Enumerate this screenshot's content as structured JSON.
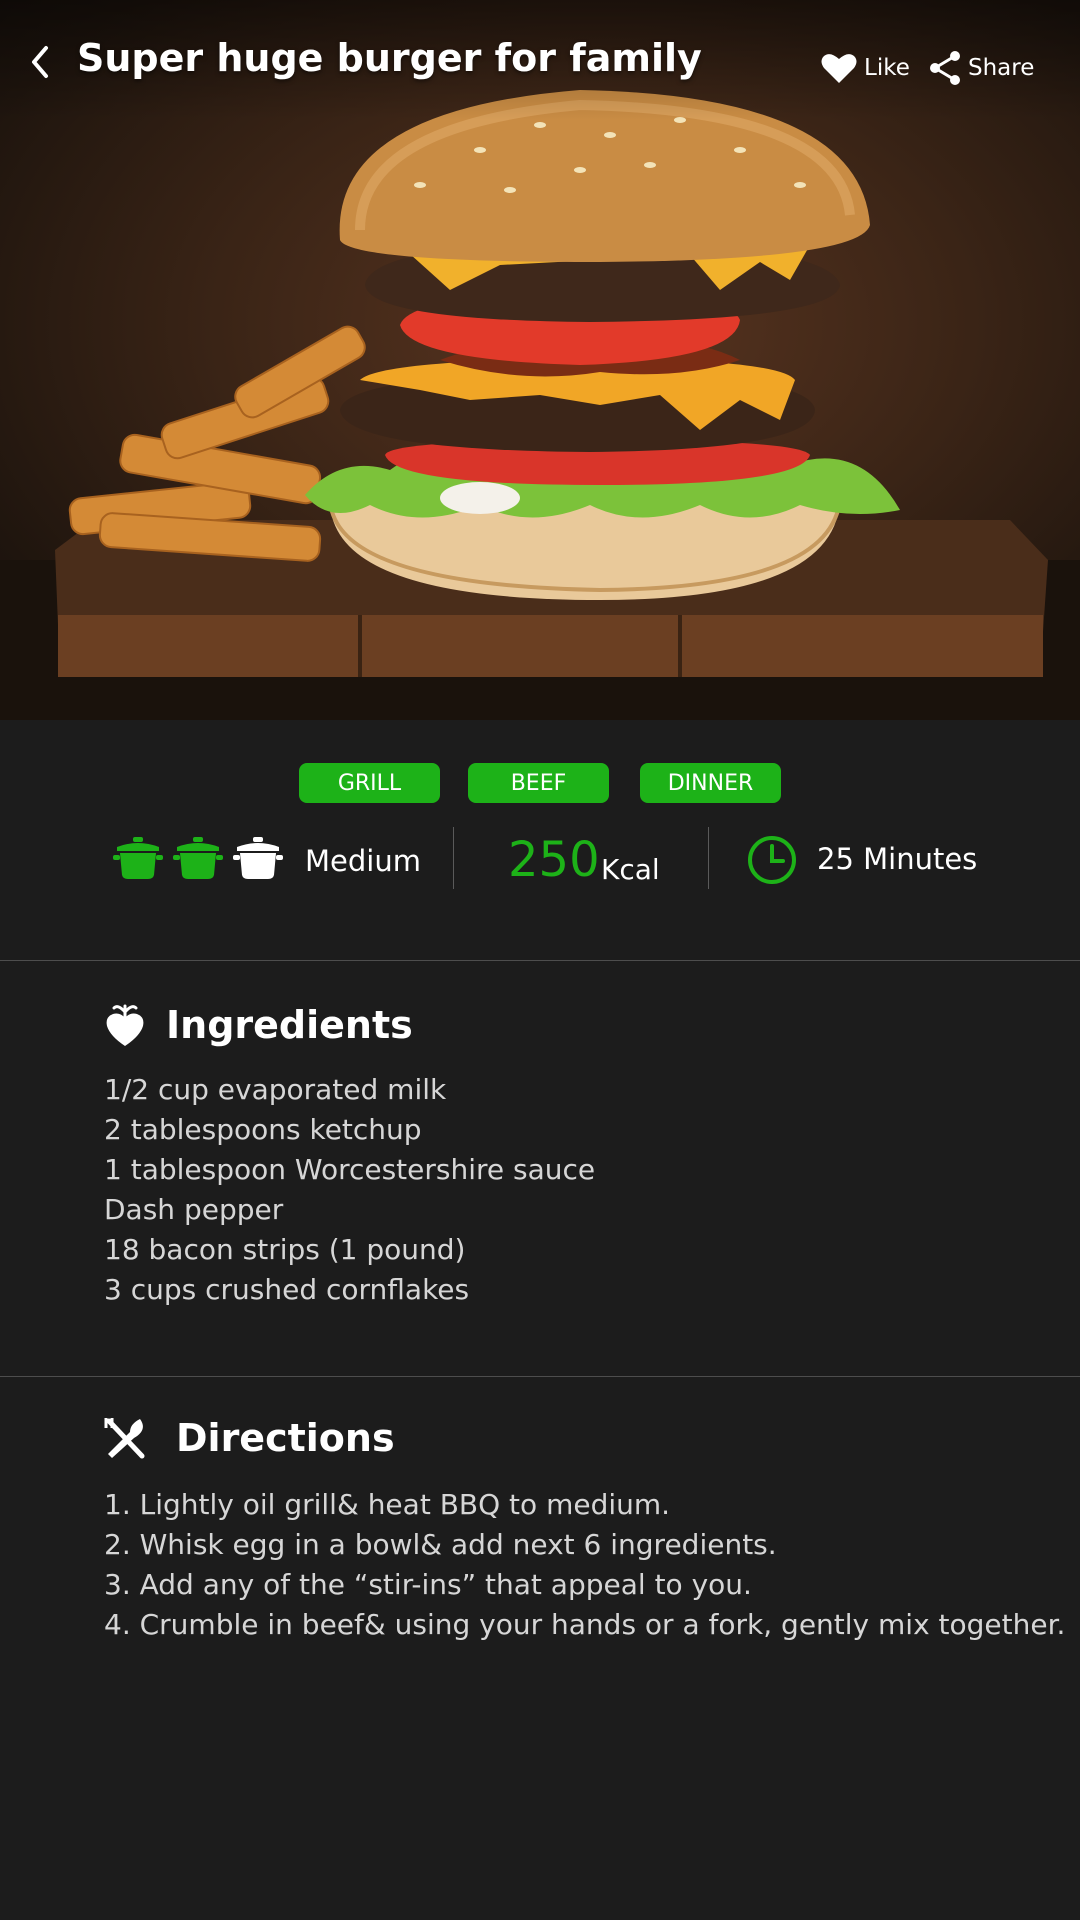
{
  "header": {
    "title": "Super huge burger for family",
    "back_icon": "chevron-left-icon",
    "like_label": "Like",
    "like_icon": "heart-icon",
    "share_label": "Share",
    "share_icon": "share-icon"
  },
  "tags": [
    "GRILL",
    "BEEF",
    "DINNER"
  ],
  "stats": {
    "difficulty_label": "Medium",
    "difficulty_level": 2,
    "difficulty_max": 3,
    "difficulty_icon": "pot-icon",
    "kcal_value": "250",
    "kcal_unit": "Kcal",
    "time_label": "25 Minutes",
    "time_icon": "clock-icon"
  },
  "ingredients": {
    "title": "Ingredients",
    "icon": "beet-icon",
    "items": [
      "1/2 cup evaporated milk",
      "2 tablespoons ketchup",
      "1 tablespoon Worcestershire sauce",
      "Dash pepper",
      "18 bacon strips (1 pound)",
      "3 cups crushed cornflakes"
    ]
  },
  "directions": {
    "title": "Directions",
    "icon": "fork-knife-icon",
    "steps": [
      "1. Lightly oil grill& heat BBQ to medium.",
      "2. Whisk egg in a bowl& add next 6 ingredients.",
      "3. Add any of the “stir-ins” that appeal to you.",
      "4. Crumble in beef& using your hands or a fork, gently mix together."
    ]
  },
  "colors": {
    "accent": "#1db218",
    "background": "#1c1c1c",
    "body_text": "#d6d6d6"
  }
}
